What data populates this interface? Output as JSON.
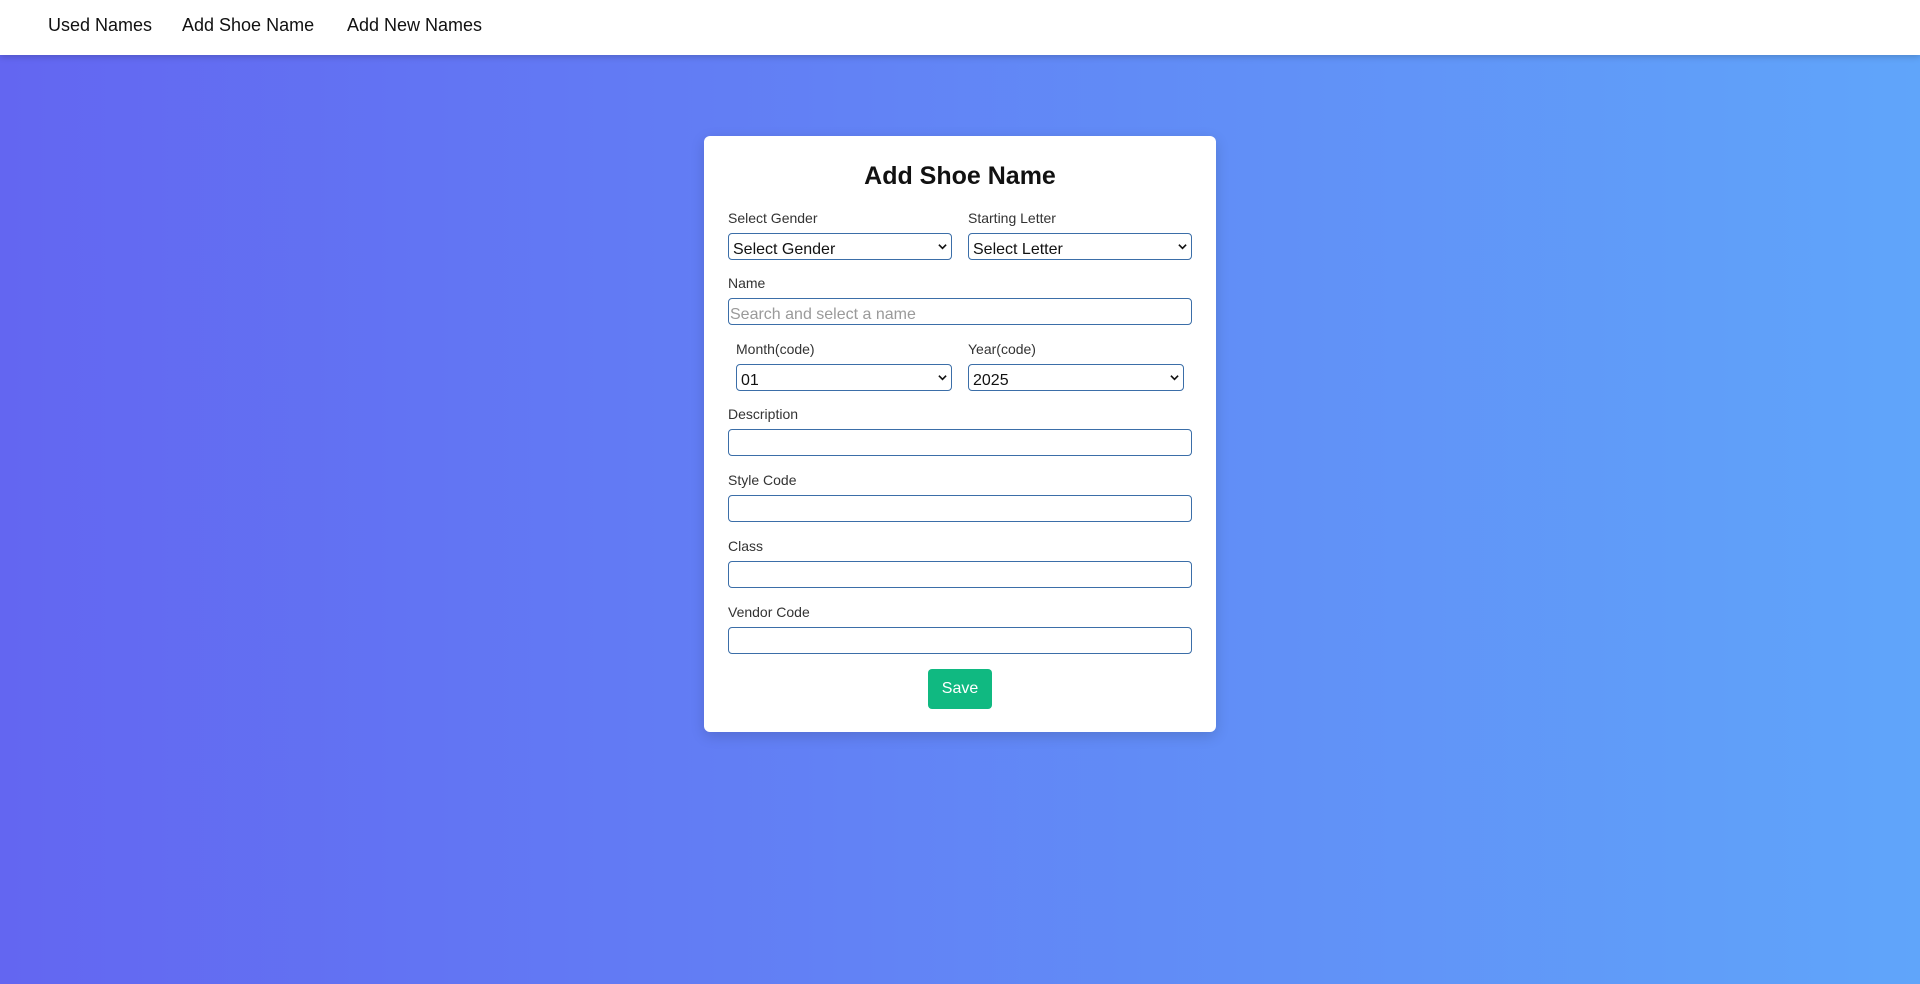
{
  "nav": {
    "items": [
      {
        "label": "Used Names"
      },
      {
        "label": "Add Shoe Name"
      },
      {
        "label": "Add New Names"
      }
    ]
  },
  "form": {
    "title": "Add Shoe Name",
    "gender": {
      "label": "Select Gender",
      "value": "Select Gender"
    },
    "letter": {
      "label": "Starting Letter",
      "value": "Select Letter"
    },
    "name": {
      "label": "Name",
      "value": "",
      "placeholder": "Search and select a name"
    },
    "month": {
      "label": "Month(code)",
      "value": "01"
    },
    "year": {
      "label": "Year(code)",
      "value": "2025"
    },
    "description": {
      "label": "Description",
      "value": ""
    },
    "style_code": {
      "label": "Style Code",
      "value": ""
    },
    "class": {
      "label": "Class",
      "value": ""
    },
    "vendor_code": {
      "label": "Vendor Code",
      "value": ""
    },
    "save_label": "Save"
  },
  "colors": {
    "gradient_start": "#6366f1",
    "gradient_end": "#60a5fa",
    "input_border": "#3b6ea8",
    "save_button": "#10b981"
  }
}
